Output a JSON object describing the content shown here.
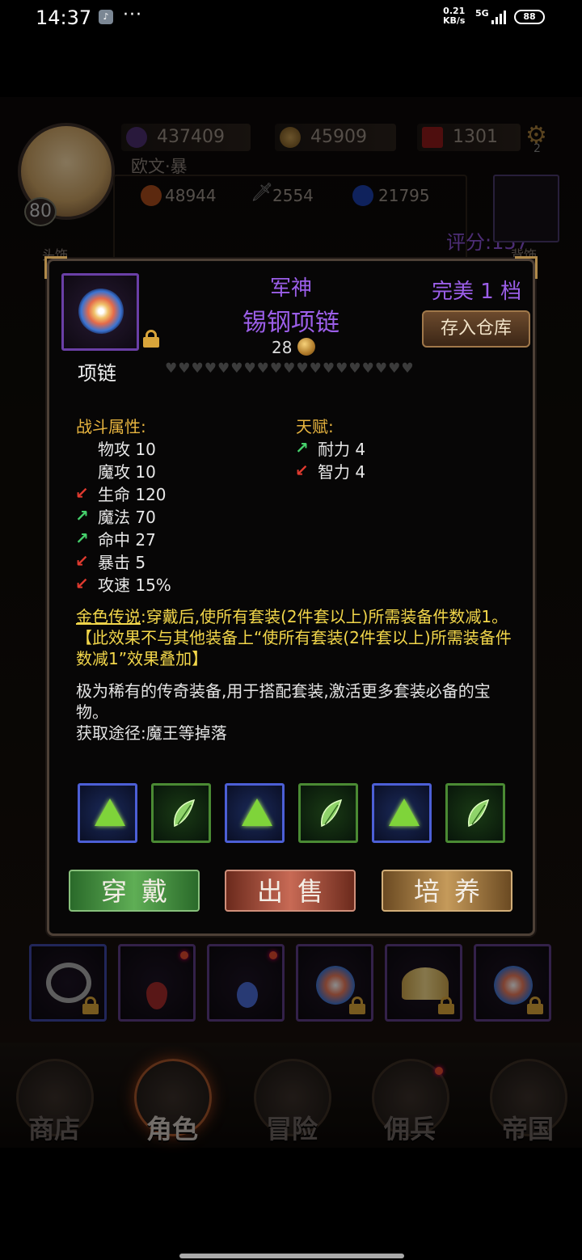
{
  "status_bar": {
    "time": "14:37",
    "dots": "···",
    "net_speed_value": "0.21",
    "net_speed_unit": "KB/s",
    "signal": "5G",
    "battery": "88"
  },
  "player": {
    "level": "80",
    "name": "欧文·暴",
    "score_label": "评分:157",
    "resources": [
      "437409",
      "45909",
      "1301"
    ],
    "settings_badge": "2",
    "stats": [
      "48944",
      "2554",
      "21795"
    ]
  },
  "background_labels": {
    "head": "头饰",
    "back": "背饰"
  },
  "item": {
    "prefix": "军神",
    "name": "锡钢项链",
    "price": "28",
    "perfect": "完美 1 档",
    "store_button": "存入仓库",
    "slot_type": "项链",
    "hearts": "♥♥♥♥♥♥♥♥♥♥♥♥♥♥♥♥♥♥♥",
    "combat_header": "战斗属性:",
    "talent_header": "天赋:",
    "combat_attrs": [
      {
        "text": "物攻 10",
        "trend": "none"
      },
      {
        "text": "魔攻 10",
        "trend": "none"
      },
      {
        "text": "生命 120",
        "trend": "down"
      },
      {
        "text": "魔法 70",
        "trend": "up"
      },
      {
        "text": "命中 27",
        "trend": "up"
      },
      {
        "text": "暴击 5",
        "trend": "down"
      },
      {
        "text": "攻速 15%",
        "trend": "down"
      }
    ],
    "talent_attrs": [
      {
        "text": "耐力 4",
        "trend": "up"
      },
      {
        "text": "智力 4",
        "trend": "down"
      }
    ],
    "legend_title": "金色传说",
    "legend_text": ":穿戴后,使所有套装(2件套以上)所需装备件数减1。【此效果不与其他装备上“使所有套装(2件套以上)所需装备件数减1”效果叠加】",
    "desc_line1": "极为稀有的传奇装备,用于搭配套装,激活更多套装必备的宝物。",
    "desc_line2": "获取途径:魔王等掉落",
    "gems": [
      "triangle",
      "leaf",
      "triangle",
      "leaf",
      "triangle",
      "leaf"
    ]
  },
  "actions": {
    "wear": "穿戴",
    "sell": "出售",
    "train": "培养"
  },
  "nav": [
    "商店",
    "角色",
    "冒险",
    "佣兵",
    "帝国"
  ],
  "colors": {
    "epic_purple": "#9b5ee8",
    "legend_gold": "#f2d64a",
    "up_green": "#46d16c",
    "down_red": "#e03a2f"
  }
}
